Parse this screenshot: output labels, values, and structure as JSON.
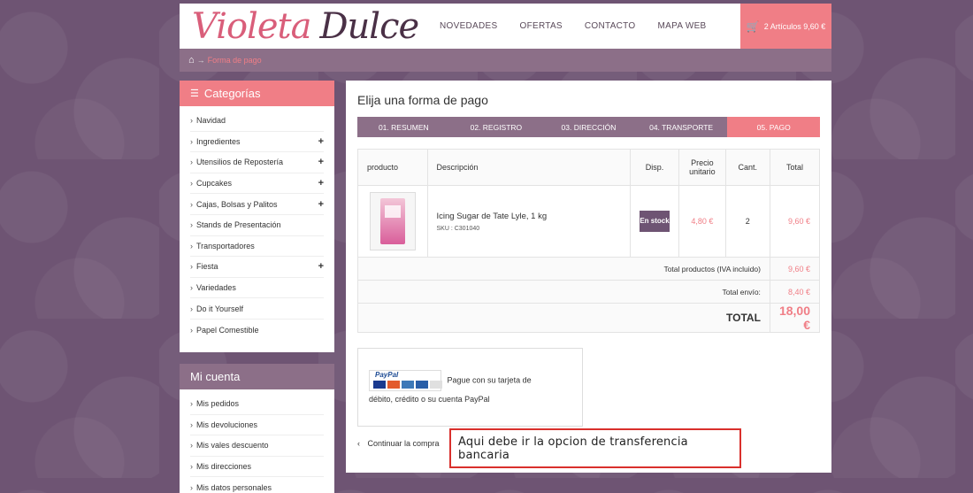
{
  "logo": {
    "first": "Violeta",
    "second": "Dulce"
  },
  "nav": [
    "NOVEDADES",
    "OFERTAS",
    "CONTACTO",
    "MAPA WEB"
  ],
  "cart": {
    "label": "2 Artículos 9,60 €",
    "icon": "cart-icon"
  },
  "breadcrumb": {
    "home_icon": "home-icon",
    "separator": "→",
    "current": "Forma de pago"
  },
  "sidebar": {
    "categories_title": "Categorías",
    "categories": [
      {
        "label": "Navidad",
        "expandable": false
      },
      {
        "label": "Ingredientes",
        "expandable": true
      },
      {
        "label": "Utensilios de Repostería",
        "expandable": true
      },
      {
        "label": "Cupcakes",
        "expandable": true
      },
      {
        "label": "Cajas, Bolsas y Palitos",
        "expandable": true
      },
      {
        "label": "Stands de Presentación",
        "expandable": false
      },
      {
        "label": "Transportadores",
        "expandable": false
      },
      {
        "label": "Fiesta",
        "expandable": true
      },
      {
        "label": "Variedades",
        "expandable": false
      },
      {
        "label": "Do it Yourself",
        "expandable": false
      },
      {
        "label": "Papel Comestible",
        "expandable": false
      }
    ],
    "account_title": "Mi cuenta",
    "account": [
      "Mis pedidos",
      "Mis devoluciones",
      "Mis vales descuento",
      "Mis direcciones",
      "Mis datos personales"
    ]
  },
  "main": {
    "title": "Elija una forma de pago",
    "steps": [
      "01. RESUMEN",
      "02. REGISTRO",
      "03. DIRECCIÓN",
      "04. TRANSPORTE",
      "05. PAGO"
    ],
    "active_step": 4,
    "table": {
      "headers": {
        "product": "producto",
        "description": "Descripción",
        "availability": "Disp.",
        "unit_price": "Precio unitario",
        "qty": "Cant.",
        "total": "Total"
      },
      "item": {
        "name": "Icing Sugar de Tate Lyle, 1 kg",
        "sku": "SKU : C301040",
        "stock": "En stock",
        "unit_price": "4,80 €",
        "qty": "2",
        "total": "9,60 €"
      },
      "total_products_label": "Total productos (IVA incluido)",
      "total_products": "9,60 €",
      "shipping_label": "Total envío:",
      "shipping": "8,40 €",
      "grand_label": "TOTAL",
      "grand_total": "18,00 €"
    },
    "paypal": {
      "logo_text": "PayPal",
      "text_line1": "Pague con su tarjeta de",
      "text_line2": "débito, crédito o su cuenta PayPal"
    },
    "continue": "Continuar la compra"
  },
  "note": "Aqui debe ir la opcion de transferencia bancaria"
}
